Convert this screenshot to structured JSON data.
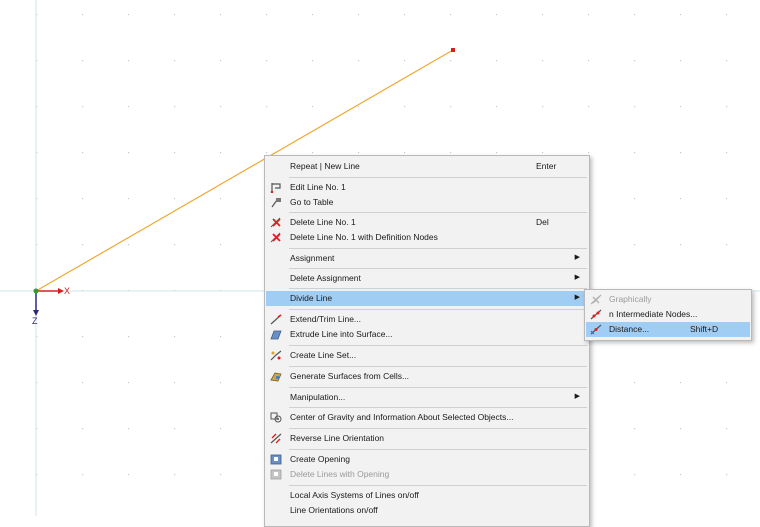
{
  "viewport": {
    "axis_x_label": "X",
    "axis_z_label": "Z",
    "line_color": "#f0a830",
    "node_color": "#d32020"
  },
  "context_menu": {
    "items": [
      {
        "label": "Repeat | New Line",
        "shortcut": "Enter",
        "icon": "none"
      },
      {
        "label": "Edit Line No. 1",
        "icon": "edit-line-icon"
      },
      {
        "label": "Go to Table",
        "icon": "go-to-table-icon"
      },
      {
        "label": "Delete Line No. 1",
        "shortcut": "Del",
        "icon": "delete-icon"
      },
      {
        "label": "Delete Line No. 1 with Definition Nodes",
        "icon": "delete-with-nodes-icon"
      },
      {
        "label": "Assignment",
        "submenu_arrow": "▶"
      },
      {
        "label": "Delete Assignment",
        "submenu_arrow": "▶"
      },
      {
        "label": "Divide Line",
        "submenu_arrow": "▶",
        "highlighted": true
      },
      {
        "label": "Extend/Trim Line...",
        "icon": "extend-trim-icon"
      },
      {
        "label": "Extrude Line into Surface...",
        "icon": "extrude-surface-icon"
      },
      {
        "label": "Create Line Set...",
        "icon": "line-set-icon"
      },
      {
        "label": "Generate Surfaces from Cells...",
        "icon": "generate-surfaces-icon"
      },
      {
        "label": "Manipulation...",
        "submenu_arrow": "▶"
      },
      {
        "label": "Center of Gravity and Information About Selected Objects...",
        "icon": "center-gravity-icon"
      },
      {
        "label": "Reverse Line Orientation",
        "icon": "reverse-orientation-icon"
      },
      {
        "label": "Create Opening",
        "icon": "create-opening-icon"
      },
      {
        "label": "Delete Lines with Opening",
        "icon": "delete-opening-icon",
        "disabled": true
      },
      {
        "label": "Local Axis Systems of Lines on/off"
      },
      {
        "label": "Line Orientations on/off"
      }
    ]
  },
  "submenu": {
    "items": [
      {
        "label": "Graphically",
        "icon": "graphically-icon",
        "disabled": true
      },
      {
        "label": "n Intermediate Nodes...",
        "icon": "intermediate-nodes-icon"
      },
      {
        "label": "Distance...",
        "shortcut": "Shift+D",
        "icon": "distance-icon",
        "highlighted": true
      }
    ]
  }
}
